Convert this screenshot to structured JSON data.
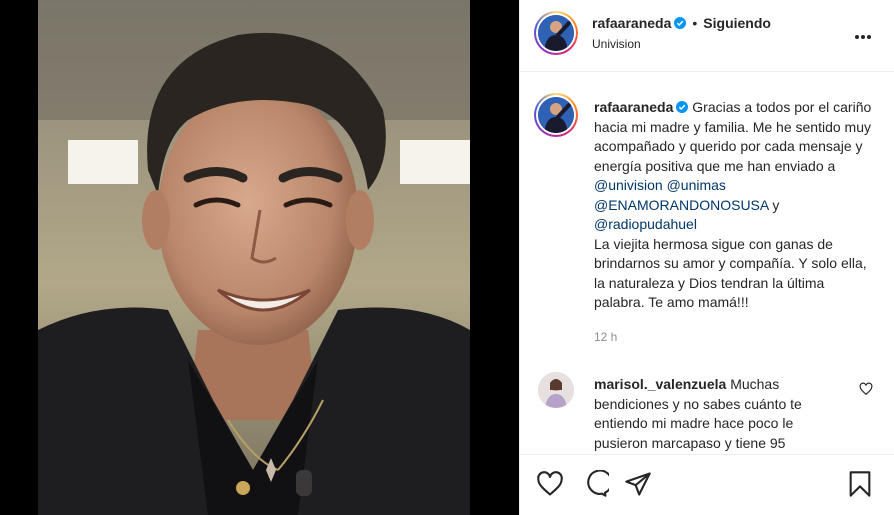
{
  "post": {
    "username": "rafaaraneda",
    "separator": "•",
    "follow_status": "Siguiendo",
    "location": "Univision"
  },
  "caption": {
    "username": "rafaaraneda",
    "text_1": "Gracias a todos por el cariño hacia mi madre y familia. Me he sentido muy acompañado y querido por cada mensaje y energía positiva que me han enviado a ",
    "mention_1": "@univision",
    "mention_2": "@unimas",
    "mention_3": "@ENAMORANDONOSUSA",
    "text_and": " y ",
    "mention_4": "@radiopudahuel",
    "text_2": "La viejita hermosa sigue con ganas de brindarnos su amor y compañía. Y solo ella, la naturaleza y Dios tendran la última palabra. Te amo mamá!!!",
    "time": "12 h"
  },
  "comment": {
    "username": "marisol._valenzuela",
    "text": "Muchas bendiciones y no sabes cuánto te entiendo mi madre hace poco le pusieron marcapaso y tiene 95"
  },
  "icons": {
    "verified": "verified-badge-icon",
    "more": "more-options-icon",
    "like": "heart-icon",
    "comment": "comment-icon",
    "share": "share-icon",
    "save": "bookmark-icon"
  },
  "colors": {
    "mention": "#00376b",
    "verified": "#0095f6",
    "muted": "#8e8e8e",
    "text": "#262626"
  }
}
